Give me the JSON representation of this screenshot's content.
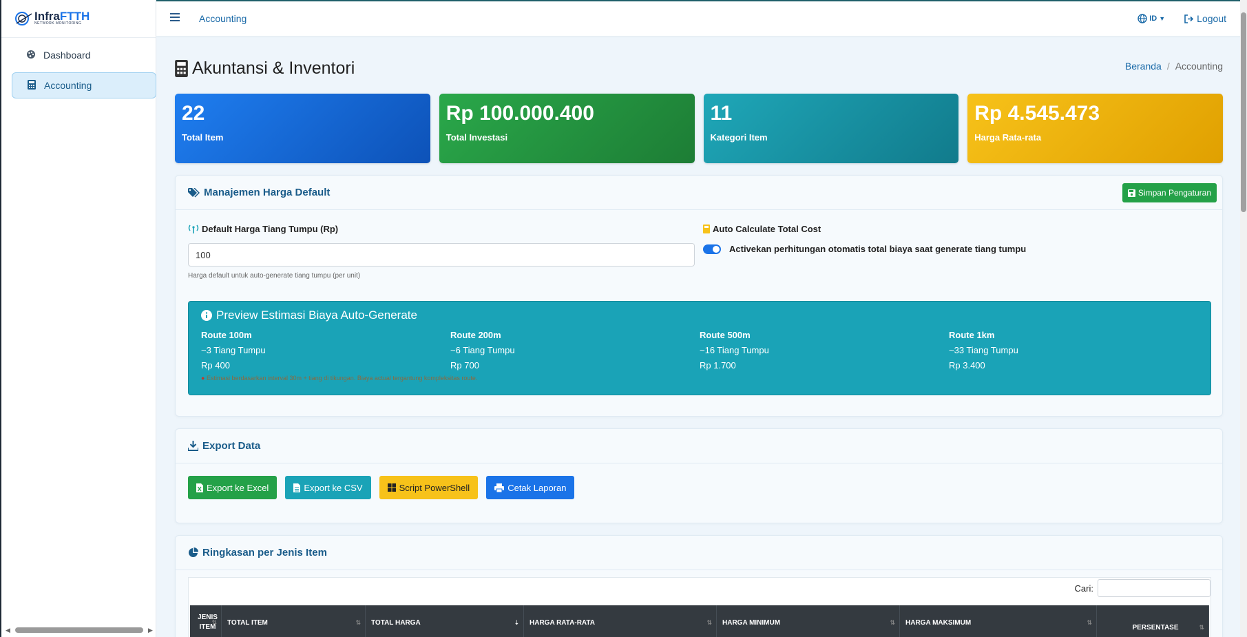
{
  "brand": {
    "name_a": "Infra",
    "name_b": "FTTH",
    "tagline": "NETWORK MONITORING"
  },
  "sidebar": {
    "items": [
      {
        "label": "Dashboard",
        "icon": "palette-icon"
      },
      {
        "label": "Accounting",
        "icon": "calculator-icon"
      }
    ]
  },
  "topbar": {
    "title": "Accounting",
    "lang": "ID",
    "logout": "Logout"
  },
  "page": {
    "title": "Akuntansi & Inventori"
  },
  "breadcrumb": {
    "home": "Beranda",
    "current": "Accounting"
  },
  "stats": [
    {
      "value": "22",
      "label": "Total Item"
    },
    {
      "value": "Rp 100.000.400",
      "label": "Total Investasi"
    },
    {
      "value": "11",
      "label": "Kategori Item"
    },
    {
      "value": "Rp 4.545.473",
      "label": "Harga Rata-rata"
    }
  ],
  "pricing": {
    "title": "Manajemen Harga Default",
    "save_label": "Simpan Pengaturan",
    "default_label": "Default Harga Tiang Tumpu (Rp)",
    "default_value": "100",
    "default_hint": "Harga default untuk auto-generate tiang tumpu (per unit)",
    "auto_label": "Auto Calculate Total Cost",
    "auto_toggle_label": "Activekan perhitungan otomatis total biaya saat generate tiang tumpu",
    "preview": {
      "title": "Preview Estimasi Biaya Auto-Generate",
      "routes": [
        {
          "route": "Route 100m",
          "poles": "~3 Tiang Tumpu",
          "cost": "Rp 400"
        },
        {
          "route": "Route 200m",
          "poles": "~6 Tiang Tumpu",
          "cost": "Rp 700"
        },
        {
          "route": "Route 500m",
          "poles": "~16 Tiang Tumpu",
          "cost": "Rp 1.700"
        },
        {
          "route": "Route 1km",
          "poles": "~33 Tiang Tumpu",
          "cost": "Rp 3.400"
        }
      ],
      "note": "Estimasi berdasarkan interval 30m + tiang di tikungan. Biaya actual tergantung kompleksitas route."
    }
  },
  "export": {
    "title": "Export Data",
    "excel": "Export ke Excel",
    "csv": "Export ke CSV",
    "ps": "Script PowerShell",
    "print": "Cetak Laporan"
  },
  "summary": {
    "title": "Ringkasan per Jenis Item",
    "search_label": "Cari:",
    "columns": [
      "JENIS ITEM",
      "TOTAL ITEM",
      "TOTAL HARGA",
      "HARGA RATA-RATA",
      "HARGA MINIMUM",
      "HARGA MAKSIMUM",
      "PERSENTASE"
    ]
  },
  "colors": {
    "blue": "#1a73e8",
    "green": "#24a148",
    "teal": "#1aa3b7",
    "yellow": "#f7c21a"
  }
}
